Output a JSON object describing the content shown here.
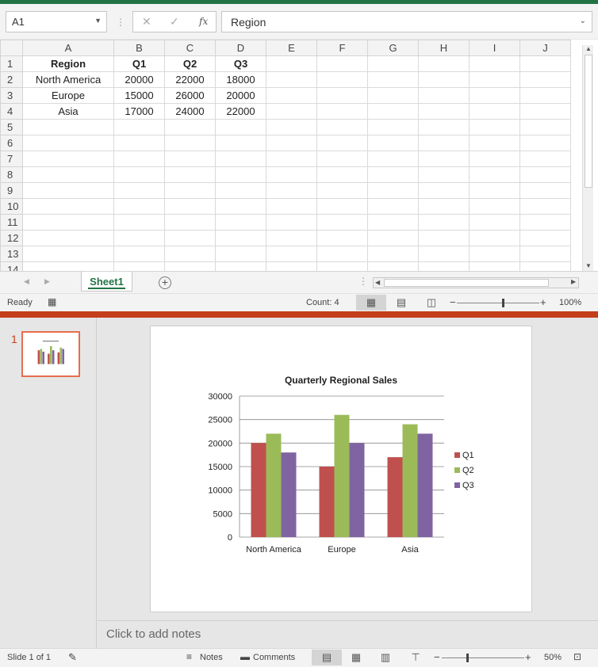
{
  "excel": {
    "name_box": "A1",
    "formula_value": "Region",
    "formula_icons": {
      "cancel": "✕",
      "enter": "✓",
      "fx": "fx"
    },
    "columns": [
      "A",
      "B",
      "C",
      "D",
      "E",
      "F",
      "G",
      "H",
      "I",
      "J"
    ],
    "rows": [
      {
        "num": "1",
        "cells": [
          "Region",
          "Q1",
          "Q2",
          "Q3"
        ],
        "bold": true
      },
      {
        "num": "2",
        "cells": [
          "North America",
          "20000",
          "22000",
          "18000"
        ]
      },
      {
        "num": "3",
        "cells": [
          "Europe",
          "15000",
          "26000",
          "20000"
        ]
      },
      {
        "num": "4",
        "cells": [
          "Asia",
          "17000",
          "24000",
          "22000"
        ]
      },
      {
        "num": "5",
        "cells": []
      },
      {
        "num": "6",
        "cells": []
      },
      {
        "num": "7",
        "cells": []
      },
      {
        "num": "8",
        "cells": []
      },
      {
        "num": "9",
        "cells": []
      },
      {
        "num": "10",
        "cells": []
      },
      {
        "num": "11",
        "cells": []
      },
      {
        "num": "12",
        "cells": []
      },
      {
        "num": "13",
        "cells": []
      },
      {
        "num": "14",
        "cells": []
      }
    ],
    "sheet_tab": "Sheet1",
    "status": {
      "ready": "Ready",
      "count": "Count: 4",
      "zoom": "100%"
    },
    "zoom_level": 0.55
  },
  "powerpoint": {
    "slide_number": "1",
    "notes_placeholder": "Click to add notes",
    "status": {
      "slide": "Slide 1 of 1",
      "notes": "Notes",
      "comments": "Comments",
      "zoom": "50%"
    },
    "zoom_level": 0.3
  },
  "colors": {
    "excel_green": "#217346",
    "ppt_orange": "#c43e1c",
    "q1": "#c0504d",
    "q2": "#9bbb59",
    "q3": "#8064a2"
  },
  "chart_data": {
    "type": "bar",
    "title": "Quarterly Regional Sales",
    "categories": [
      "North America",
      "Europe",
      "Asia"
    ],
    "series": [
      {
        "name": "Q1",
        "values": [
          20000,
          15000,
          17000
        ],
        "color": "#c0504d"
      },
      {
        "name": "Q2",
        "values": [
          22000,
          26000,
          24000
        ],
        "color": "#9bbb59"
      },
      {
        "name": "Q3",
        "values": [
          18000,
          20000,
          22000
        ],
        "color": "#8064a2"
      }
    ],
    "ylim": [
      0,
      30000
    ],
    "yticks": [
      "30000",
      "25000",
      "20000",
      "15000",
      "10000",
      "5000",
      "0"
    ],
    "grid": true,
    "legend": "right"
  }
}
